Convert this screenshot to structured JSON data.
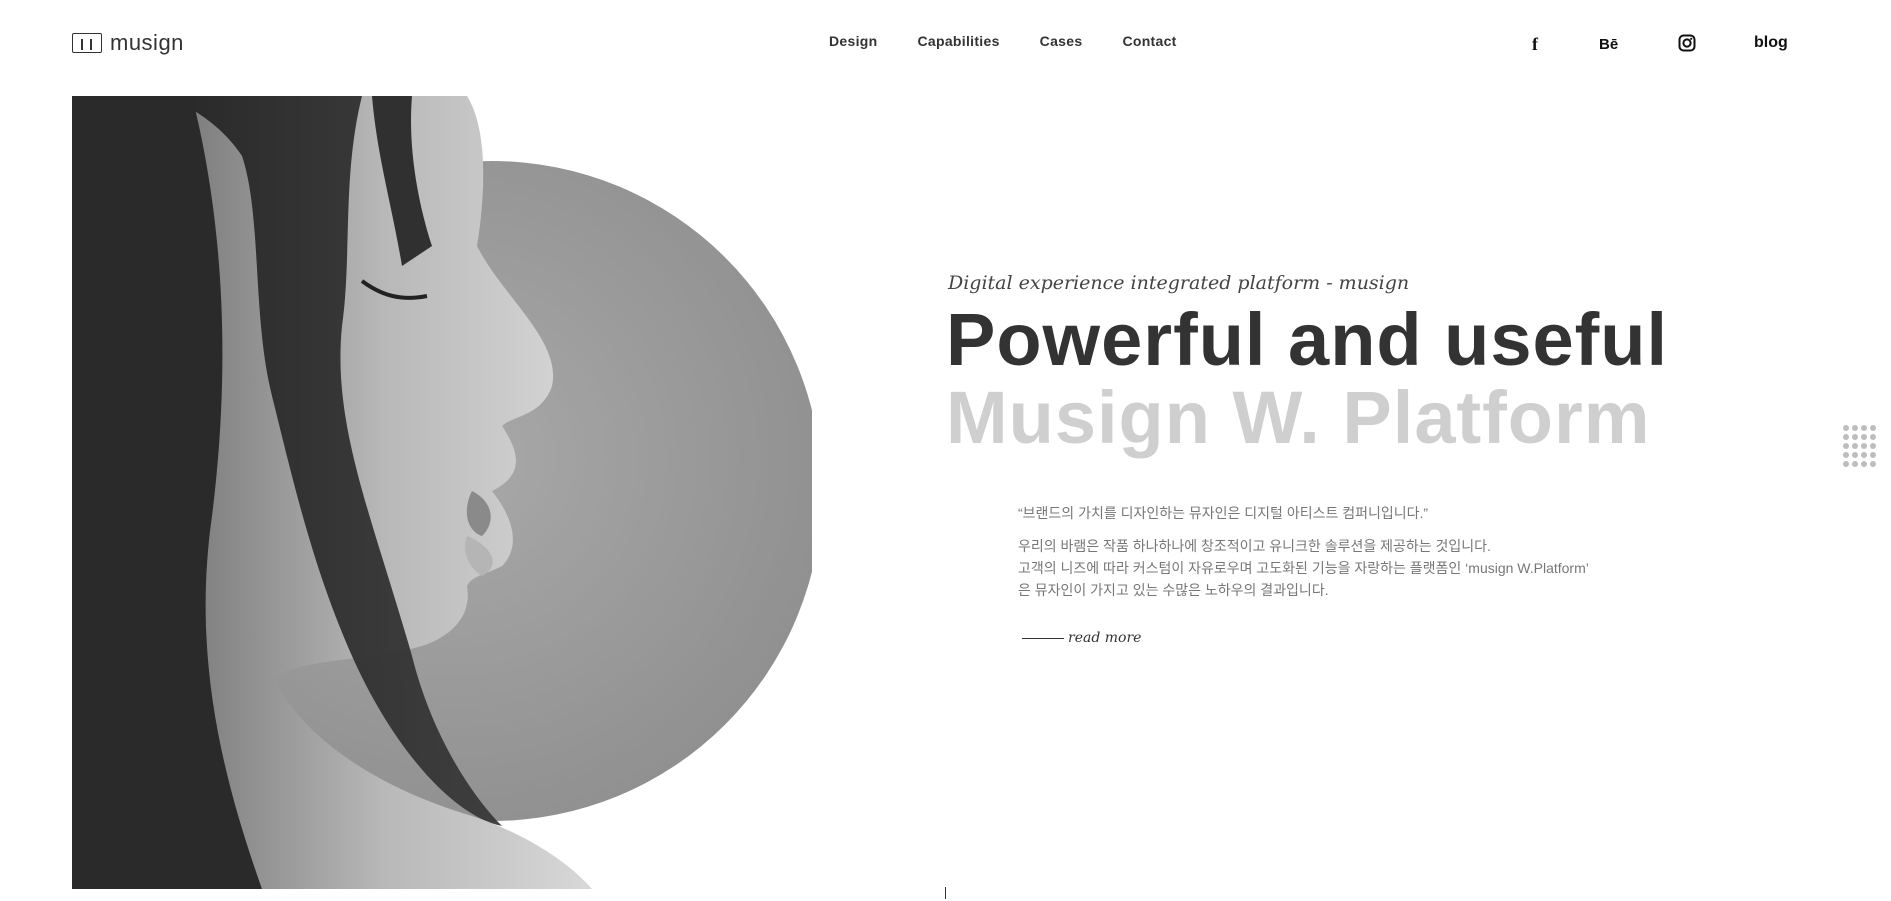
{
  "brand": {
    "name": "musign"
  },
  "nav": [
    {
      "label": "Design"
    },
    {
      "label": "Capabilities"
    },
    {
      "label": "Cases"
    },
    {
      "label": "Contact"
    }
  ],
  "social": {
    "facebook": "f",
    "behance": "Bē",
    "instagram_icon": "instagram-icon",
    "blog": "blog"
  },
  "hero": {
    "subtitle": "Digital experience integrated platform - musign",
    "headline_line1": "Powerful and useful",
    "headline_line2": "Musign W. Platform",
    "quote": "“브랜드의 가치를 디자인하는 뮤자인은 디지털 아티스트 컴퍼니입니다.”",
    "description": [
      "우리의 바램은 작품 하나하나에 창조적이고 유니크한 솔루션을 제공하는 것입니다.",
      "고객의 니즈에 따라 커스텀이 자유로우며 고도화된 기능을 자랑하는 플랫폼인 ‘musign W.Platform’",
      "은 뮤자인이 가지고 있는 수많은 노하우의 결과입니다."
    ],
    "read_more": "read more"
  },
  "colors": {
    "primary_text": "#333333",
    "light_headline": "#cfcfcf",
    "body_text": "#777777",
    "circle_gray": "#9d9d9d"
  }
}
